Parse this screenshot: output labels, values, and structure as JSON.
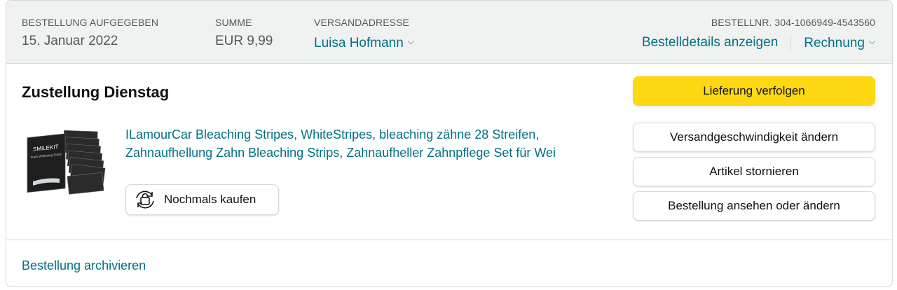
{
  "header": {
    "placed_label": "BESTELLUNG AUFGEGEBEN",
    "placed_value": "15. Januar 2022",
    "total_label": "SUMME",
    "total_value": "EUR 9,99",
    "ship_label": "VERSANDADRESSE",
    "ship_value": "Luisa Hofmann",
    "order_number": "BESTELLNR. 304-1066949-4543560",
    "details_link": "Bestelldetails anzeigen",
    "invoice_link": "Rechnung"
  },
  "shipment": {
    "title": "Zustellung Dienstag",
    "product_title": "ILamourCar Bleaching Stripes, WhiteStripes, bleaching zähne 28 Streifen, Zahnaufhellung Zahn Bleaching Strips, Zahnaufheller Zahnpflege Set für Wei",
    "buy_again": "Nochmals kaufen",
    "thumbnail_brand": "SMILEKIT",
    "thumbnail_sub": "Teeth Whitening Strips"
  },
  "actions": {
    "track": "Lieferung verfolgen",
    "change_speed": "Versandgeschwindigkeit ändern",
    "cancel": "Artikel stornieren",
    "view_edit": "Bestellung ansehen oder ändern"
  },
  "footer": {
    "archive": "Bestellung archivieren"
  },
  "colors": {
    "link": "#007185",
    "primary_button": "#ffd814",
    "header_bg": "#f0f2f2"
  }
}
